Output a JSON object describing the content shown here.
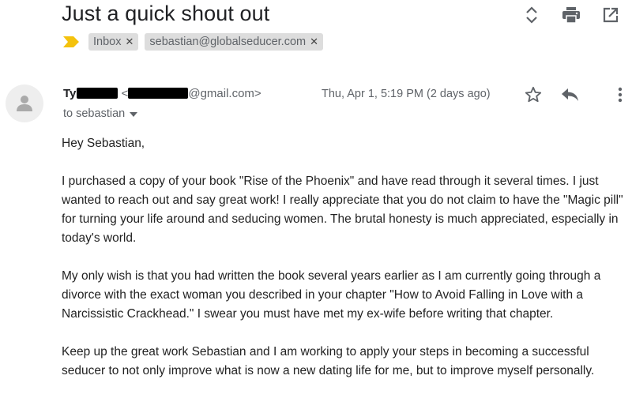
{
  "subject": "Just a quick shout out",
  "labels": {
    "inbox": "Inbox",
    "recipient_tag": "sebastian@globalseducer.com"
  },
  "sender": {
    "name_visible": "Ty",
    "email_prefix": "<",
    "email_suffix": "@gmail.com>"
  },
  "date": "Thu, Apr 1, 5:19 PM (2 days ago)",
  "to_line": "to sebastian",
  "body": {
    "greeting": "Hey Sebastian,",
    "p1": "I purchased a copy of your book \"Rise of the Phoenix\" and have read through it several times.  I just wanted to reach out and say great work!  I really appreciate that you do not claim to have the \"Magic pill\" for turning your life around and seducing women. The brutal honesty is much appreciated, especially in today's world.",
    "p2": "My only wish is that you had written the book several years earlier as I am currently going through a divorce with the exact woman you described in your chapter \"How to Avoid Falling in Love with a Narcissistic Crackhead.\" I swear you must have met my ex-wife before writing that chapter.",
    "p3": "Keep up the great work Sebastian and I am working to apply your steps in becoming a successful seducer to not only improve what is now a new dating life for me, but to improve myself personally."
  },
  "colors": {
    "importance_marker": "#f4c20d",
    "chip_bg": "#dddddd",
    "icon_gray": "#5f6368",
    "redaction": "#000000"
  },
  "icons": [
    "expand-collapse-icon",
    "print-icon",
    "open-in-new-window-icon",
    "importance-marker-icon",
    "default-avatar-icon",
    "star-icon",
    "reply-icon",
    "more-vert-icon",
    "dropdown-arrow-icon"
  ]
}
